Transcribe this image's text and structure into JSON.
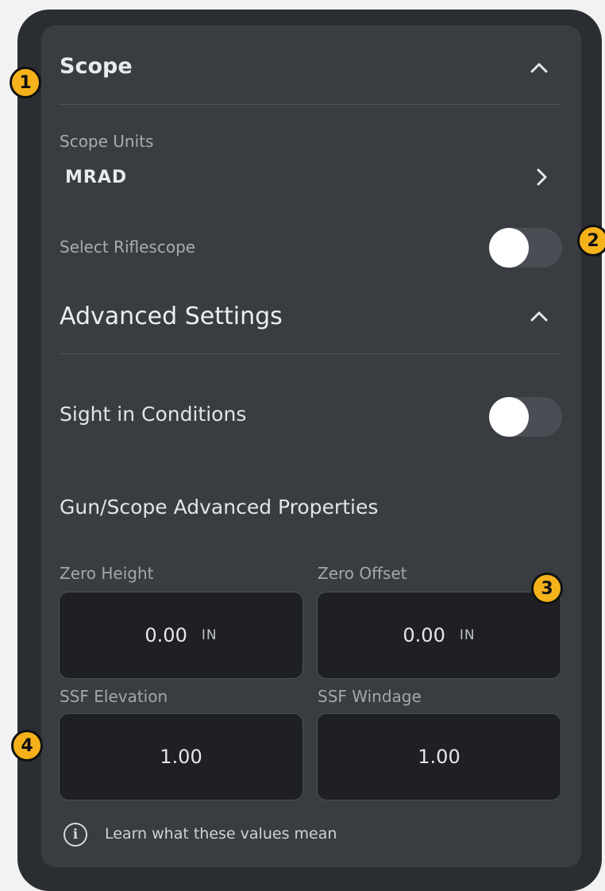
{
  "scope": {
    "title": "Scope",
    "collapse_icon": "chevron-up-icon",
    "units_label": "Scope Units",
    "units_value": "MRAD",
    "units_icon": "chevron-right-icon",
    "riflescope_label": "Select Riflescope",
    "riflescope_enabled": false
  },
  "advanced": {
    "title": "Advanced Settings",
    "collapse_icon": "chevron-up-icon",
    "sight_in_label": "Sight in Conditions",
    "sight_in_enabled": false,
    "properties_title": "Gun/Scope Advanced Properties",
    "fields": {
      "zero_height": {
        "label": "Zero Height",
        "value": "0.00",
        "unit": "IN"
      },
      "zero_offset": {
        "label": "Zero Offset",
        "value": "0.00",
        "unit": "IN"
      },
      "ssf_elevation": {
        "label": "SSF Elevation",
        "value": "1.00"
      },
      "ssf_windage": {
        "label": "SSF Windage",
        "value": "1.00"
      }
    },
    "info_icon": "info-icon",
    "info_text": "Learn what these values mean"
  },
  "callouts": [
    "1",
    "2",
    "3",
    "4"
  ],
  "colors": {
    "device": "#2a2d31",
    "panel": "#393c41",
    "input_bg": "#1e2024",
    "callout": "#f5b21b"
  }
}
